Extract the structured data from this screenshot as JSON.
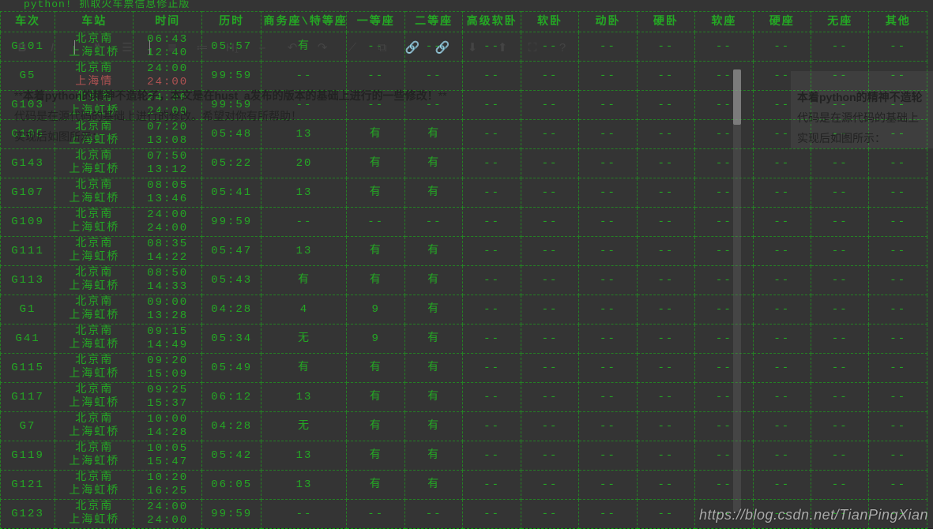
{
  "title_line": "python! 抓取火车票信息修正版",
  "headers": [
    "车次",
    "车站",
    "时间",
    "历时",
    "商务座\\特等座",
    "一等座",
    "二等座",
    "高级软卧",
    "软卧",
    "动卧",
    "硬卧",
    "软座",
    "硬座",
    "无座",
    "其他"
  ],
  "rows": [
    {
      "id": "G101",
      "from": "北京南",
      "to": "上海虹桥",
      "dep": "06:43",
      "arr": "12:40",
      "dur": "05:57",
      "cols": [
        "有",
        "--",
        "--",
        "--",
        "--",
        "--",
        "--",
        "--",
        "--",
        "--",
        "--"
      ]
    },
    {
      "id": "G5",
      "from": "北京南",
      "to": "上海情",
      "dep": "24:00",
      "arr": "24:00",
      "dur": "99:59",
      "cols": [
        "--",
        "--",
        "--",
        "--",
        "--",
        "--",
        "--",
        "--",
        "--",
        "--",
        "--"
      ],
      "red": true
    },
    {
      "id": "G103",
      "from": "北京南",
      "to": "上海虹桥",
      "dep": "24:00",
      "arr": "24:00",
      "dur": "99:59",
      "cols": [
        "--",
        "--",
        "--",
        "--",
        "--",
        "--",
        "--",
        "--",
        "--",
        "--",
        "--"
      ]
    },
    {
      "id": "G105",
      "from": "北京南",
      "to": "上海虹桥",
      "dep": "07:20",
      "arr": "13:08",
      "dur": "05:48",
      "cols": [
        "13",
        "有",
        "有",
        "--",
        "--",
        "--",
        "--",
        "--",
        "--",
        "--",
        "--"
      ]
    },
    {
      "id": "G143",
      "from": "北京南",
      "to": "上海虹桥",
      "dep": "07:50",
      "arr": "13:12",
      "dur": "05:22",
      "cols": [
        "20",
        "有",
        "有",
        "--",
        "--",
        "--",
        "--",
        "--",
        "--",
        "--",
        "--"
      ]
    },
    {
      "id": "G107",
      "from": "北京南",
      "to": "上海虹桥",
      "dep": "08:05",
      "arr": "13:46",
      "dur": "05:41",
      "cols": [
        "13",
        "有",
        "有",
        "--",
        "--",
        "--",
        "--",
        "--",
        "--",
        "--",
        "--"
      ]
    },
    {
      "id": "G109",
      "from": "北京南",
      "to": "上海虹桥",
      "dep": "24:00",
      "arr": "24:00",
      "dur": "99:59",
      "cols": [
        "--",
        "--",
        "--",
        "--",
        "--",
        "--",
        "--",
        "--",
        "--",
        "--",
        "--"
      ]
    },
    {
      "id": "G111",
      "from": "北京南",
      "to": "上海虹桥",
      "dep": "08:35",
      "arr": "14:22",
      "dur": "05:47",
      "cols": [
        "13",
        "有",
        "有",
        "--",
        "--",
        "--",
        "--",
        "--",
        "--",
        "--",
        "--"
      ]
    },
    {
      "id": "G113",
      "from": "北京南",
      "to": "上海虹桥",
      "dep": "08:50",
      "arr": "14:33",
      "dur": "05:43",
      "cols": [
        "有",
        "有",
        "有",
        "--",
        "--",
        "--",
        "--",
        "--",
        "--",
        "--",
        "--"
      ]
    },
    {
      "id": "G1",
      "from": "北京南",
      "to": "上海虹桥",
      "dep": "09:00",
      "arr": "13:28",
      "dur": "04:28",
      "cols": [
        "4",
        "9",
        "有",
        "--",
        "--",
        "--",
        "--",
        "--",
        "--",
        "--",
        "--"
      ]
    },
    {
      "id": "G41",
      "from": "北京南",
      "to": "上海虹桥",
      "dep": "09:15",
      "arr": "14:49",
      "dur": "05:34",
      "cols": [
        "无",
        "9",
        "有",
        "--",
        "--",
        "--",
        "--",
        "--",
        "--",
        "--",
        "--"
      ]
    },
    {
      "id": "G115",
      "from": "北京南",
      "to": "上海虹桥",
      "dep": "09:20",
      "arr": "15:09",
      "dur": "05:49",
      "cols": [
        "有",
        "有",
        "有",
        "--",
        "--",
        "--",
        "--",
        "--",
        "--",
        "--",
        "--"
      ]
    },
    {
      "id": "G117",
      "from": "北京南",
      "to": "上海虹桥",
      "dep": "09:25",
      "arr": "15:37",
      "dur": "06:12",
      "cols": [
        "13",
        "有",
        "有",
        "--",
        "--",
        "--",
        "--",
        "--",
        "--",
        "--",
        "--"
      ]
    },
    {
      "id": "G7",
      "from": "北京南",
      "to": "上海虹桥",
      "dep": "10:00",
      "arr": "14:28",
      "dur": "04:28",
      "cols": [
        "无",
        "有",
        "有",
        "--",
        "--",
        "--",
        "--",
        "--",
        "--",
        "--",
        "--"
      ]
    },
    {
      "id": "G119",
      "from": "北京南",
      "to": "上海虹桥",
      "dep": "10:05",
      "arr": "15:47",
      "dur": "05:42",
      "cols": [
        "13",
        "有",
        "有",
        "--",
        "--",
        "--",
        "--",
        "--",
        "--",
        "--",
        "--"
      ]
    },
    {
      "id": "G121",
      "from": "北京南",
      "to": "上海虹桥",
      "dep": "10:20",
      "arr": "16:25",
      "dur": "06:05",
      "cols": [
        "13",
        "有",
        "有",
        "--",
        "--",
        "--",
        "--",
        "--",
        "--",
        "--",
        "--"
      ]
    },
    {
      "id": "G123",
      "from": "北京南",
      "to": "上海虹桥",
      "dep": "24:00",
      "arr": "24:00",
      "dur": "99:59",
      "cols": [
        "--",
        "--",
        "--",
        "--",
        "--",
        "--",
        "--",
        "--",
        "--",
        "--",
        "--"
      ]
    }
  ],
  "toolbar": {
    "bold": "B",
    "italic": "I",
    "quote": "❝",
    "h_line": "☰",
    "h1": "H₁",
    "hr": "⎯",
    "undo": "↶",
    "redo": "↷",
    "underline": "⟋",
    "copy": "⧉",
    "link": "🔗",
    "download": "⬇",
    "upload": "⬆",
    "expand": "⛶",
    "help": "?",
    "list_ul": "≣",
    "list_ol": "≔"
  },
  "editor": {
    "line1_prefix": "**",
    "line1_bold": "本着python的精神不造轮子，本文是在hust_a发布的版本的基础上进行的一些修改！",
    "line1_suffix": "**",
    "line2": "代码是在源代码的基础上进行的修改。希望对你有所帮助！",
    "line3": "实现后如图所示："
  },
  "preview": {
    "line1": "本着python的精神不造轮",
    "line2": "代码是在源代码的基础上",
    "line3": "实现后如图所示："
  },
  "watermark": "https://blog.csdn.net/TianPingXian"
}
